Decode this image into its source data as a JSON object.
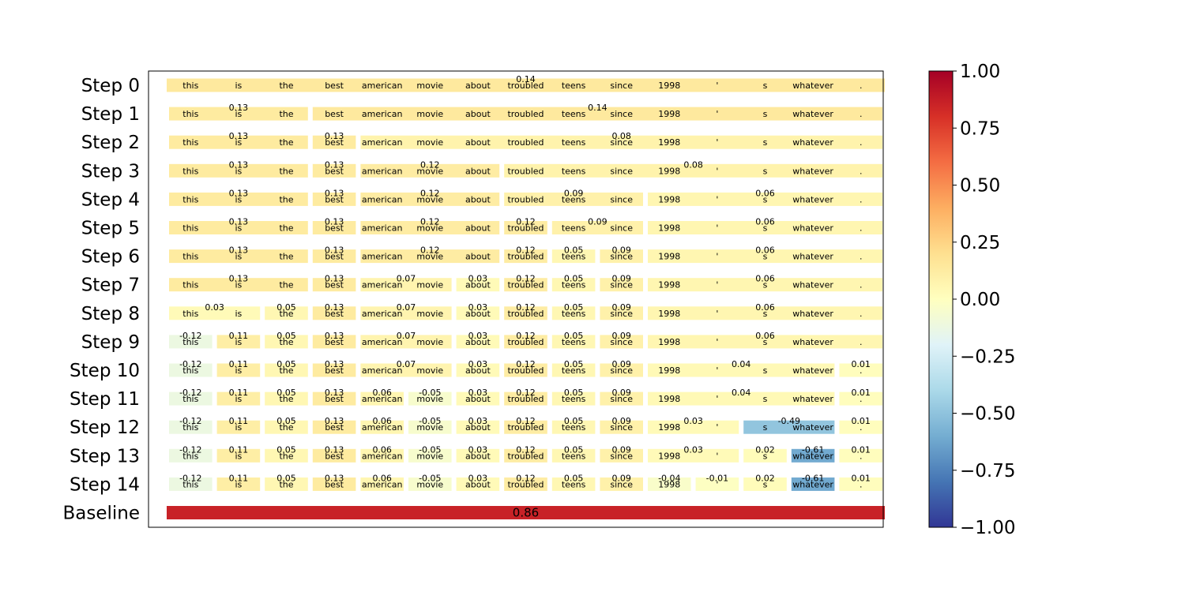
{
  "chart_data": {
    "type": "heatmap",
    "description_type": "token attribution heatmap",
    "tokens": [
      "this",
      "is",
      "the",
      "best",
      "american",
      "movie",
      "about",
      "troubled",
      "teens",
      "since",
      "1998",
      "'",
      "s",
      "whatever",
      "."
    ],
    "rows": [
      {
        "label": "Step 0",
        "segments": [
          {
            "start": 0,
            "end": 14,
            "value": 0.14
          }
        ]
      },
      {
        "label": "Step 1",
        "segments": [
          {
            "start": 0,
            "end": 2,
            "value": 0.13
          },
          {
            "start": 3,
            "end": 14,
            "value": 0.14
          }
        ]
      },
      {
        "label": "Step 2",
        "segments": [
          {
            "start": 0,
            "end": 2,
            "value": 0.13
          },
          {
            "start": 3,
            "end": 3,
            "value": 0.13
          },
          {
            "start": 4,
            "end": 14,
            "value": 0.08
          }
        ]
      },
      {
        "label": "Step 3",
        "segments": [
          {
            "start": 0,
            "end": 2,
            "value": 0.13
          },
          {
            "start": 3,
            "end": 3,
            "value": 0.13
          },
          {
            "start": 4,
            "end": 6,
            "value": 0.12
          },
          {
            "start": 7,
            "end": 14,
            "value": 0.08
          }
        ]
      },
      {
        "label": "Step 4",
        "segments": [
          {
            "start": 0,
            "end": 2,
            "value": 0.13
          },
          {
            "start": 3,
            "end": 3,
            "value": 0.13
          },
          {
            "start": 4,
            "end": 6,
            "value": 0.12
          },
          {
            "start": 7,
            "end": 9,
            "value": 0.09
          },
          {
            "start": 10,
            "end": 14,
            "value": 0.06
          }
        ]
      },
      {
        "label": "Step 5",
        "segments": [
          {
            "start": 0,
            "end": 2,
            "value": 0.13
          },
          {
            "start": 3,
            "end": 3,
            "value": 0.13
          },
          {
            "start": 4,
            "end": 6,
            "value": 0.12
          },
          {
            "start": 7,
            "end": 7,
            "value": 0.12
          },
          {
            "start": 8,
            "end": 9,
            "value": 0.09
          },
          {
            "start": 10,
            "end": 14,
            "value": 0.06
          }
        ]
      },
      {
        "label": "Step 6",
        "segments": [
          {
            "start": 0,
            "end": 2,
            "value": 0.13
          },
          {
            "start": 3,
            "end": 3,
            "value": 0.13
          },
          {
            "start": 4,
            "end": 6,
            "value": 0.12
          },
          {
            "start": 7,
            "end": 7,
            "value": 0.12
          },
          {
            "start": 8,
            "end": 8,
            "value": 0.05
          },
          {
            "start": 9,
            "end": 9,
            "value": 0.09
          },
          {
            "start": 10,
            "end": 14,
            "value": 0.06
          }
        ]
      },
      {
        "label": "Step 7",
        "segments": [
          {
            "start": 0,
            "end": 2,
            "value": 0.13
          },
          {
            "start": 3,
            "end": 3,
            "value": 0.13
          },
          {
            "start": 4,
            "end": 5,
            "value": 0.07
          },
          {
            "start": 6,
            "end": 6,
            "value": 0.03
          },
          {
            "start": 7,
            "end": 7,
            "value": 0.12
          },
          {
            "start": 8,
            "end": 8,
            "value": 0.05
          },
          {
            "start": 9,
            "end": 9,
            "value": 0.09
          },
          {
            "start": 10,
            "end": 14,
            "value": 0.06
          }
        ]
      },
      {
        "label": "Step 8",
        "segments": [
          {
            "start": 0,
            "end": 1,
            "value": 0.03
          },
          {
            "start": 2,
            "end": 2,
            "value": 0.05
          },
          {
            "start": 3,
            "end": 3,
            "value": 0.13
          },
          {
            "start": 4,
            "end": 5,
            "value": 0.07
          },
          {
            "start": 6,
            "end": 6,
            "value": 0.03
          },
          {
            "start": 7,
            "end": 7,
            "value": 0.12
          },
          {
            "start": 8,
            "end": 8,
            "value": 0.05
          },
          {
            "start": 9,
            "end": 9,
            "value": 0.09
          },
          {
            "start": 10,
            "end": 14,
            "value": 0.06
          }
        ]
      },
      {
        "label": "Step 9",
        "segments": [
          {
            "start": 0,
            "end": 0,
            "value": -0.12
          },
          {
            "start": 1,
            "end": 1,
            "value": 0.11
          },
          {
            "start": 2,
            "end": 2,
            "value": 0.05
          },
          {
            "start": 3,
            "end": 3,
            "value": 0.13
          },
          {
            "start": 4,
            "end": 5,
            "value": 0.07
          },
          {
            "start": 6,
            "end": 6,
            "value": 0.03
          },
          {
            "start": 7,
            "end": 7,
            "value": 0.12
          },
          {
            "start": 8,
            "end": 8,
            "value": 0.05
          },
          {
            "start": 9,
            "end": 9,
            "value": 0.09
          },
          {
            "start": 10,
            "end": 14,
            "value": 0.06
          }
        ]
      },
      {
        "label": "Step 10",
        "segments": [
          {
            "start": 0,
            "end": 0,
            "value": -0.12
          },
          {
            "start": 1,
            "end": 1,
            "value": 0.11
          },
          {
            "start": 2,
            "end": 2,
            "value": 0.05
          },
          {
            "start": 3,
            "end": 3,
            "value": 0.13
          },
          {
            "start": 4,
            "end": 5,
            "value": 0.07
          },
          {
            "start": 6,
            "end": 6,
            "value": 0.03
          },
          {
            "start": 7,
            "end": 7,
            "value": 0.12
          },
          {
            "start": 8,
            "end": 8,
            "value": 0.05
          },
          {
            "start": 9,
            "end": 9,
            "value": 0.09
          },
          {
            "start": 10,
            "end": 13,
            "value": 0.04
          },
          {
            "start": 14,
            "end": 14,
            "value": 0.01
          }
        ]
      },
      {
        "label": "Step 11",
        "segments": [
          {
            "start": 0,
            "end": 0,
            "value": -0.12
          },
          {
            "start": 1,
            "end": 1,
            "value": 0.11
          },
          {
            "start": 2,
            "end": 2,
            "value": 0.05
          },
          {
            "start": 3,
            "end": 3,
            "value": 0.13
          },
          {
            "start": 4,
            "end": 4,
            "value": 0.06
          },
          {
            "start": 5,
            "end": 5,
            "value": -0.05
          },
          {
            "start": 6,
            "end": 6,
            "value": 0.03
          },
          {
            "start": 7,
            "end": 7,
            "value": 0.12
          },
          {
            "start": 8,
            "end": 8,
            "value": 0.05
          },
          {
            "start": 9,
            "end": 9,
            "value": 0.09
          },
          {
            "start": 10,
            "end": 13,
            "value": 0.04
          },
          {
            "start": 14,
            "end": 14,
            "value": 0.01
          }
        ]
      },
      {
        "label": "Step 12",
        "segments": [
          {
            "start": 0,
            "end": 0,
            "value": -0.12
          },
          {
            "start": 1,
            "end": 1,
            "value": 0.11
          },
          {
            "start": 2,
            "end": 2,
            "value": 0.05
          },
          {
            "start": 3,
            "end": 3,
            "value": 0.13
          },
          {
            "start": 4,
            "end": 4,
            "value": 0.06
          },
          {
            "start": 5,
            "end": 5,
            "value": -0.05
          },
          {
            "start": 6,
            "end": 6,
            "value": 0.03
          },
          {
            "start": 7,
            "end": 7,
            "value": 0.12
          },
          {
            "start": 8,
            "end": 8,
            "value": 0.05
          },
          {
            "start": 9,
            "end": 9,
            "value": 0.09
          },
          {
            "start": 10,
            "end": 11,
            "value": 0.03
          },
          {
            "start": 12,
            "end": 13,
            "value": -0.49
          },
          {
            "start": 14,
            "end": 14,
            "value": 0.01
          }
        ]
      },
      {
        "label": "Step 13",
        "segments": [
          {
            "start": 0,
            "end": 0,
            "value": -0.12
          },
          {
            "start": 1,
            "end": 1,
            "value": 0.11
          },
          {
            "start": 2,
            "end": 2,
            "value": 0.05
          },
          {
            "start": 3,
            "end": 3,
            "value": 0.13
          },
          {
            "start": 4,
            "end": 4,
            "value": 0.06
          },
          {
            "start": 5,
            "end": 5,
            "value": -0.05
          },
          {
            "start": 6,
            "end": 6,
            "value": 0.03
          },
          {
            "start": 7,
            "end": 7,
            "value": 0.12
          },
          {
            "start": 8,
            "end": 8,
            "value": 0.05
          },
          {
            "start": 9,
            "end": 9,
            "value": 0.09
          },
          {
            "start": 10,
            "end": 11,
            "value": 0.03
          },
          {
            "start": 12,
            "end": 12,
            "value": 0.02
          },
          {
            "start": 13,
            "end": 13,
            "value": -0.61
          },
          {
            "start": 14,
            "end": 14,
            "value": 0.01
          }
        ]
      },
      {
        "label": "Step 14",
        "segments": [
          {
            "start": 0,
            "end": 0,
            "value": -0.12
          },
          {
            "start": 1,
            "end": 1,
            "value": 0.11
          },
          {
            "start": 2,
            "end": 2,
            "value": 0.05
          },
          {
            "start": 3,
            "end": 3,
            "value": 0.13
          },
          {
            "start": 4,
            "end": 4,
            "value": 0.06
          },
          {
            "start": 5,
            "end": 5,
            "value": -0.05
          },
          {
            "start": 6,
            "end": 6,
            "value": 0.03
          },
          {
            "start": 7,
            "end": 7,
            "value": 0.12
          },
          {
            "start": 8,
            "end": 8,
            "value": 0.05
          },
          {
            "start": 9,
            "end": 9,
            "value": 0.09
          },
          {
            "start": 10,
            "end": 10,
            "value": -0.04
          },
          {
            "start": 11,
            "end": 11,
            "value": -0.01
          },
          {
            "start": 12,
            "end": 12,
            "value": 0.02
          },
          {
            "start": 13,
            "end": 13,
            "value": -0.61
          },
          {
            "start": 14,
            "end": 14,
            "value": 0.01
          }
        ]
      },
      {
        "label": "Baseline",
        "segments": [
          {
            "start": 0,
            "end": 14,
            "value": 0.86
          }
        ]
      }
    ],
    "colorbar": {
      "colormap": "RdYlBu_r",
      "range": [
        -1.0,
        1.0
      ],
      "ticks": [
        "1.00",
        "0.75",
        "0.50",
        "0.25",
        "0.00",
        "−0.25",
        "−0.50",
        "−0.75",
        "−1.00"
      ]
    },
    "title": "",
    "xlabel": "",
    "ylabel": ""
  }
}
